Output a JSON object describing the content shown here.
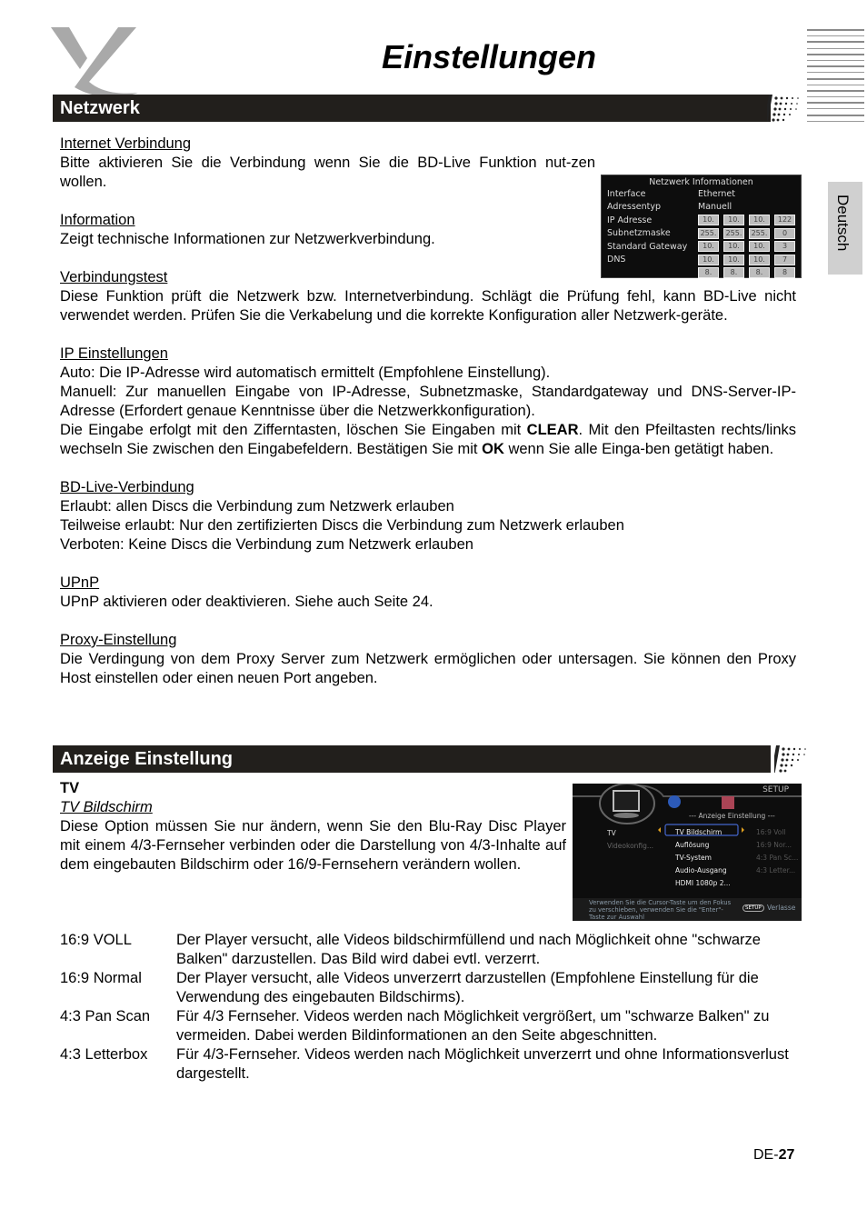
{
  "header": {
    "title": "Einstellungen",
    "language_tab": "Deutsch"
  },
  "sections": {
    "netzwerk": {
      "heading": "Netzwerk",
      "items": [
        {
          "title": "Internet Verbindung",
          "body": "Bitte aktivieren Sie die Verbindung wenn Sie die BD-Live Funktion nut-zen wollen."
        },
        {
          "title": "Information",
          "body": "Zeigt technische Informationen zur Netzwerkverbindung."
        },
        {
          "title": "Verbindungstest",
          "body": "Diese Funktion prüft die Netzwerk bzw. Internetverbindung. Schlägt die Prüfung fehl, kann BD-Live nicht verwendet werden. Prüfen Sie die Verkabelung und die korrekte Konfiguration aller Netzwerk-geräte."
        },
        {
          "title": "IP Einstellungen",
          "lines": [
            "Auto: Die IP-Adresse wird automatisch ermittelt (Empfohlene Einstellung).",
            "Manuell: Zur manuellen Eingabe von IP-Adresse, Subnetzmaske, Standardgateway und DNS-Server-IP-Adresse (Erfordert genaue Kenntnisse über die Netzwerkkonfiguration)."
          ],
          "input_text_pre": "Die Eingabe erfolgt mit den Zifferntasten, löschen Sie Eingaben mit ",
          "input_key_clear": "CLEAR",
          "input_text_mid": ". Mit den Pfeiltasten rechts/links wechseln Sie zwischen den Eingabefeldern.  Bestätigen Sie mit ",
          "input_key_ok": "OK",
          "input_text_post": " wenn Sie alle Einga-ben getätigt haben."
        },
        {
          "title": "BD-Live-Verbindung",
          "lines": [
            "Erlaubt: allen Discs die Verbindung zum Netzwerk erlauben",
            "Teilweise erlaubt: Nur den zertifizierten  Discs die Verbindung zum Netzwerk erlauben",
            "Verboten: Keine Discs die Verbindung zum Netzwerk erlauben"
          ]
        },
        {
          "title": "UPnP",
          "body": "UPnP aktivieren oder deaktivieren. Siehe auch Seite 24."
        },
        {
          "title": "Proxy-Einstellung",
          "body": "Die Verdingung von dem Proxy Server zum Netzwerk ermöglichen oder untersagen. Sie können den Proxy Host einstellen oder einen neuen Port angeben."
        }
      ],
      "screenshot": {
        "header": "Netzwerk Informationen",
        "rows": [
          {
            "label": "Interface",
            "value": "Ethernet"
          },
          {
            "label": "Adressentyp",
            "value": "Manuell"
          },
          {
            "label": "IP Adresse",
            "fields": [
              "10.",
              "10.",
              "10.",
              "122"
            ]
          },
          {
            "label": "Subnetzmaske",
            "fields": [
              "255.",
              "255.",
              "255.",
              "0"
            ]
          },
          {
            "label": "Standard Gateway",
            "fields": [
              "10.",
              "10.",
              "10.",
              "3"
            ]
          },
          {
            "label": "DNS",
            "fields": [
              "10.",
              "10.",
              "10.",
              "7"
            ]
          },
          {
            "label": "",
            "fields": [
              "8.",
              "8.",
              "8.",
              "8"
            ]
          }
        ]
      }
    },
    "anzeige": {
      "heading": "Anzeige Einstellung",
      "sub_bold": "TV",
      "sub_italic": "TV Bildschirm",
      "body": "Diese Option müssen Sie nur ändern, wenn Sie den Blu-Ray Disc Player mit einem 4/3-Fernseher verbinden oder die Darstellung von 4/3-Inhalte auf dem eingebauten Bildschirm oder 16/9-Fernsehern verändern wollen.",
      "options": [
        {
          "key": "16:9 VOLL",
          "desc": "Der Player versucht, alle Videos bildschirmfüllend und nach Möglichkeit ohne \"schwarze Balken\" darzustellen. Das Bild wird dabei evtl. verzerrt."
        },
        {
          "key": "16:9 Normal",
          "desc": "Der Player versucht, alle Videos unverzerrt darzustellen (Empfohlene Einstellung für die Verwendung des eingebauten Bildschirms)."
        },
        {
          "key": "4:3 Pan Scan",
          "desc": "Für 4/3 Fernseher. Videos werden nach Möglichkeit vergrößert, um \"schwarze Balken\" zu vermeiden.  Dabei werden Bildinformationen an den Seite abgeschnitten."
        },
        {
          "key": "4:3 Letterbox",
          "desc": "Für 4/3-Fernseher. Videos werden nach Möglichkeit unverzerrt und ohne Informationsverlust dargestellt."
        }
      ],
      "screenshot": {
        "setup_label": "SETUP",
        "menu_title": "--- Anzeige Einstellung ---",
        "left_items": [
          "TV",
          "Videokonfig..."
        ],
        "mid_items": [
          "TV Bildschirm",
          "Auflösung",
          "TV-System",
          "Audio-Ausgang",
          "HDMI 1080p 2..."
        ],
        "right_items": [
          "16:9 Voll",
          "16:9 Nor...",
          "4:3 Pan Sc...",
          "4:3 Letter..."
        ],
        "hint": "Verwenden Sie die Cursor-Taste um den Fokus zu verschieben, verwenden Sie die \"Enter\"-Taste zur Auswahl",
        "setup_button": "SETUP",
        "exit_label": "Verlasse"
      }
    }
  },
  "footer": {
    "page_prefix": "DE-",
    "page_number": "27"
  }
}
